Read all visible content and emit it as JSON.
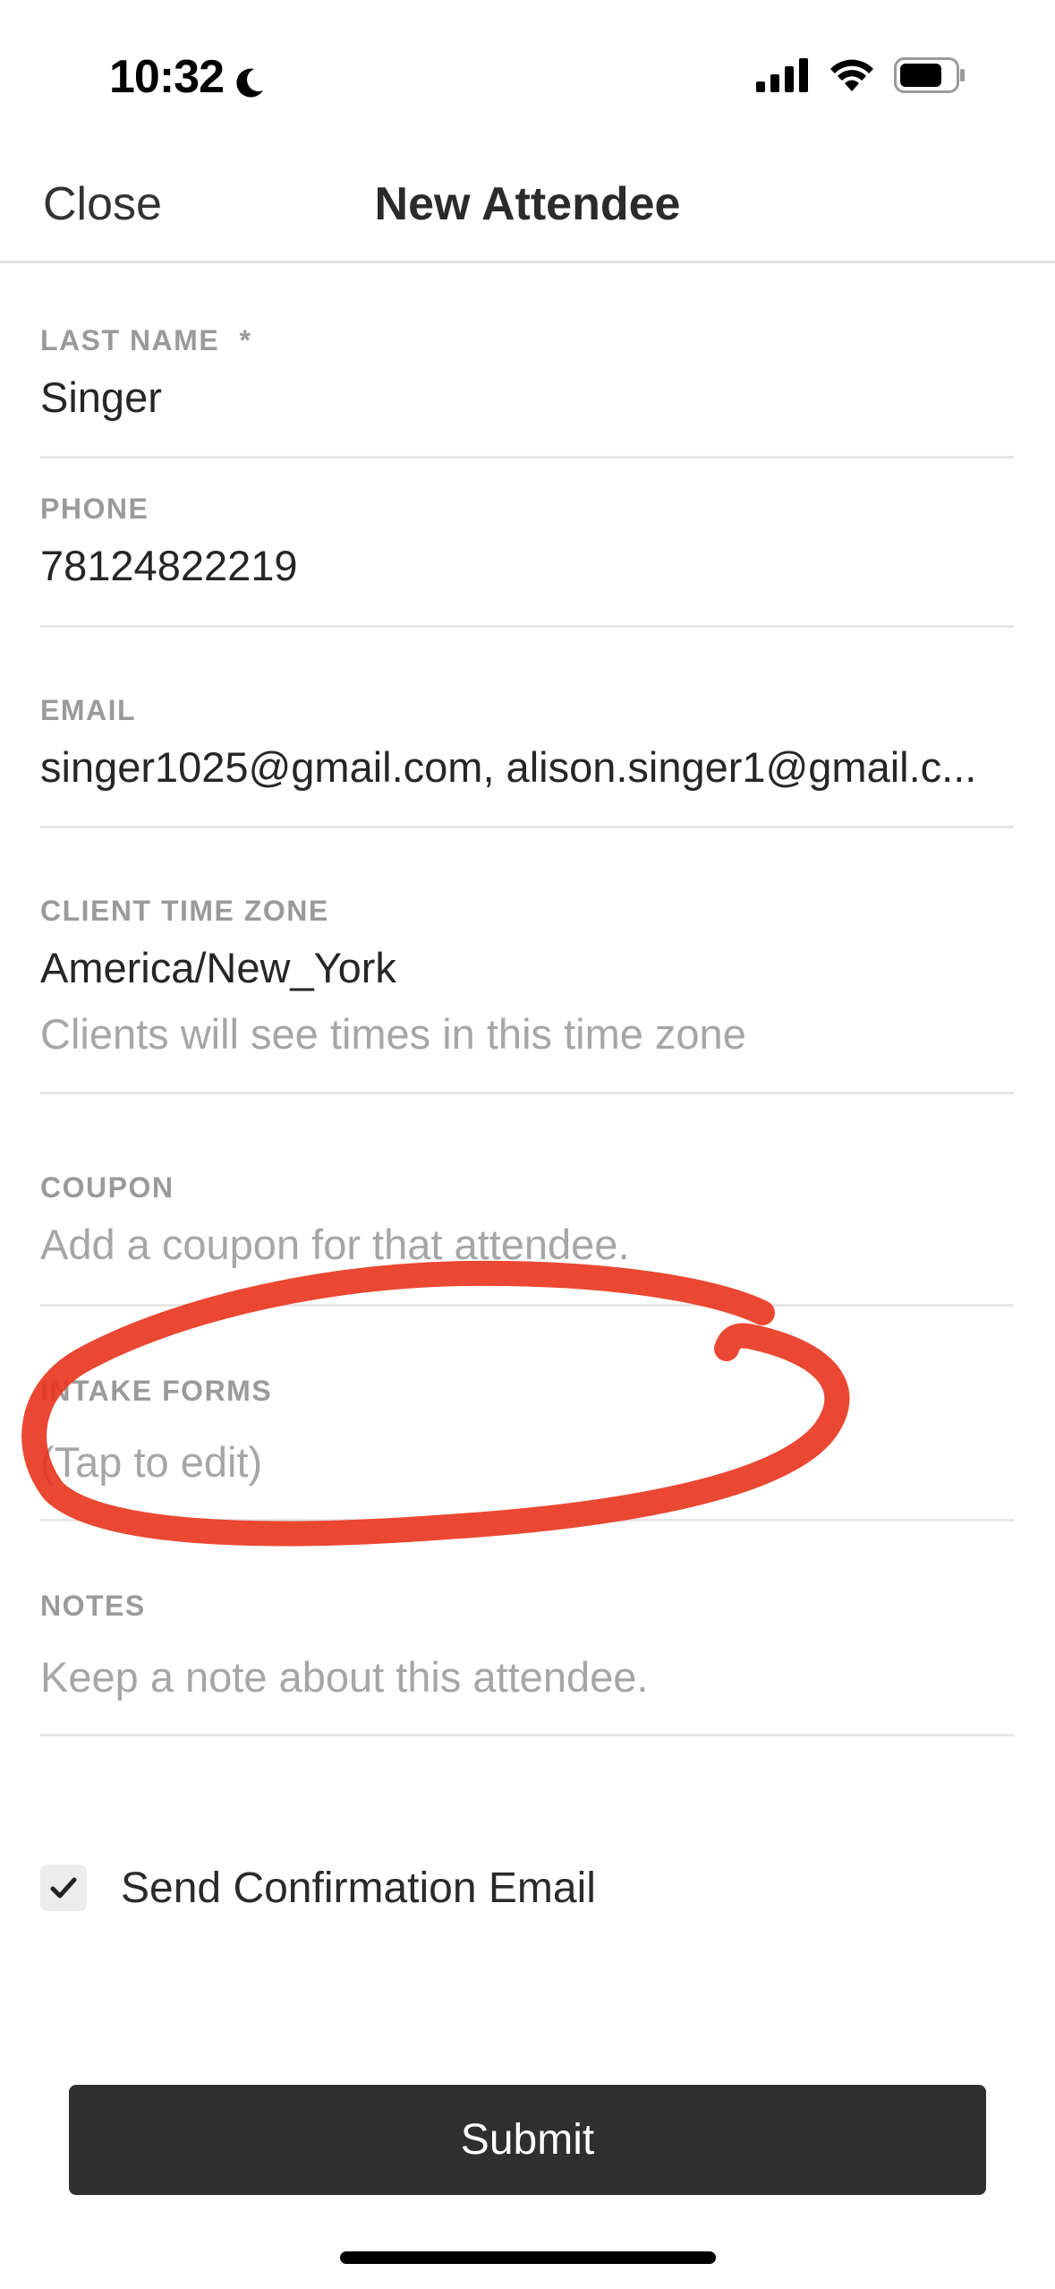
{
  "status_bar": {
    "time": "10:32",
    "icons": [
      "moon-icon",
      "cellular-signal-icon",
      "wifi-icon",
      "battery-icon"
    ]
  },
  "nav": {
    "close_label": "Close",
    "title": "New Attendee"
  },
  "fields": {
    "last_name": {
      "label": "LAST NAME",
      "required_marker": "*",
      "value": "Singer"
    },
    "phone": {
      "label": "PHONE",
      "value": "78124822219"
    },
    "email": {
      "label": "EMAIL",
      "value": "singer1025@gmail.com, alison.singer1@gmail.c..."
    },
    "time_zone": {
      "label": "CLIENT TIME ZONE",
      "value": "America/New_York",
      "hint": "Clients will see times in this time zone"
    },
    "coupon": {
      "label": "COUPON",
      "placeholder": "Add a coupon for that attendee."
    },
    "intake_forms": {
      "label": "INTAKE FORMS",
      "placeholder": "(Tap to edit)"
    },
    "notes": {
      "label": "NOTES",
      "placeholder": "Keep a note about this attendee."
    }
  },
  "confirmation": {
    "label": "Send Confirmation Email",
    "checked": true
  },
  "submit_label": "Submit",
  "colors": {
    "annotation": "#e8341c",
    "submit_background": "#2f2f2f",
    "label_gray": "#9a9a9a",
    "placeholder_gray": "#a6a6a6"
  }
}
